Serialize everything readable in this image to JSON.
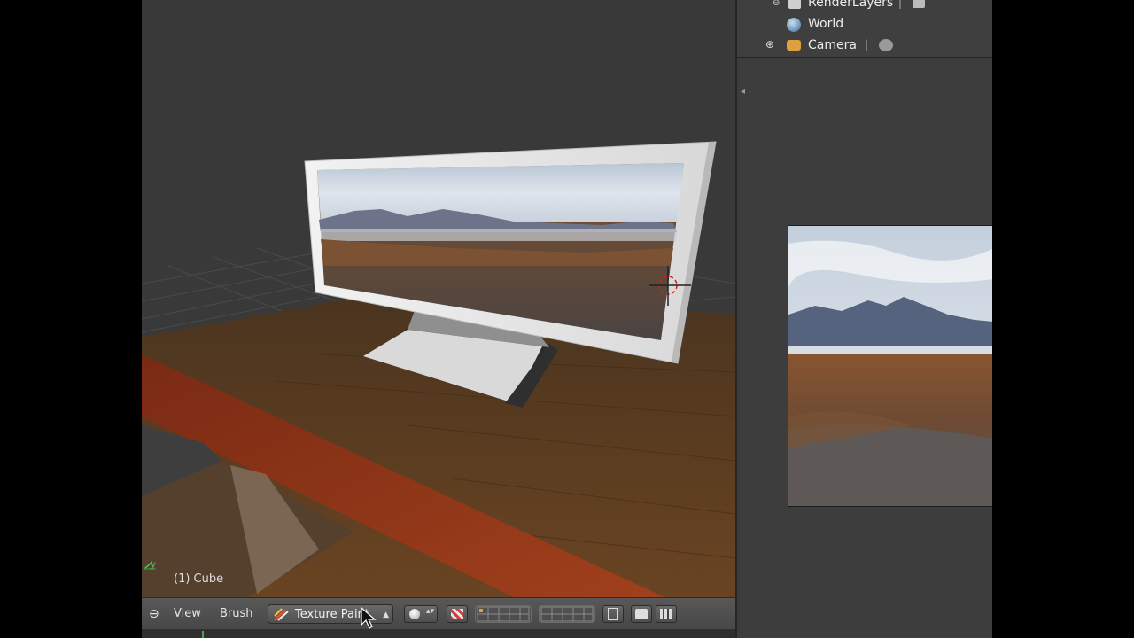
{
  "viewport": {
    "object_label": "(1) Cube"
  },
  "header": {
    "view_label": "View",
    "brush_label": "Brush",
    "mode_label": "Texture Paint"
  },
  "outliner": {
    "items": [
      {
        "label": "RenderLayers",
        "icon": "render-layers-icon"
      },
      {
        "label": "World",
        "icon": "world-icon"
      },
      {
        "label": "Camera",
        "icon": "camera-icon"
      }
    ]
  },
  "colors": {
    "viewport_bg": "#393939",
    "panel_bg": "#3d3d3d",
    "header_bg": "#4f4f4f",
    "text": "#e6e6e6",
    "table_wood": "#5a3a1e",
    "table_edge": "#8a2e16"
  }
}
